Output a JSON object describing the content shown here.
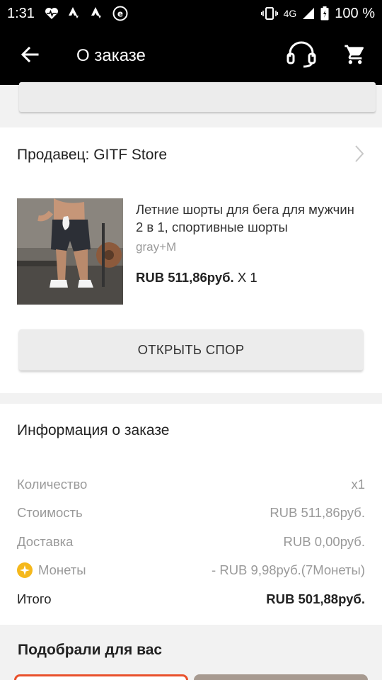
{
  "status_bar": {
    "time": "1:31",
    "network": "4G",
    "battery": "100 %",
    "icons": [
      "heart-pulse-icon",
      "strava-icon",
      "strava-icon",
      "e-circle-icon",
      "vibrate-icon",
      "signal-icon",
      "battery-icon"
    ]
  },
  "app_bar": {
    "title": "О заказе",
    "icons": [
      "back-arrow-icon",
      "headset-icon",
      "cart-icon"
    ]
  },
  "seller": {
    "label": "Продавец: GITF Store"
  },
  "product": {
    "title": "Летние шорты для бега для мужчин 2 в 1, спортивные шорты",
    "variant": "gray+M",
    "price": "RUB 511,86руб.",
    "quantity": "X 1"
  },
  "dispute_button": "ОТКРЫТЬ СПОР",
  "order_info": {
    "heading": "Информация о заказе",
    "rows": [
      {
        "label": "Количество",
        "value": "x1"
      },
      {
        "label": "Стоимость",
        "value": "RUB 511,86руб."
      },
      {
        "label": "Доставка",
        "value": "RUB 0,00руб."
      },
      {
        "label": "Монеты",
        "value": "- RUB 9,98руб.(7Монеты)"
      }
    ],
    "total": {
      "label": "Итого",
      "value": "RUB 501,88руб."
    }
  },
  "recommendations": {
    "heading": "Подобрали для вас"
  },
  "colors": {
    "bar": "#000000",
    "accent": "#e9512c",
    "coin": "#f5b81c",
    "muted_text": "#9a9a9a"
  }
}
